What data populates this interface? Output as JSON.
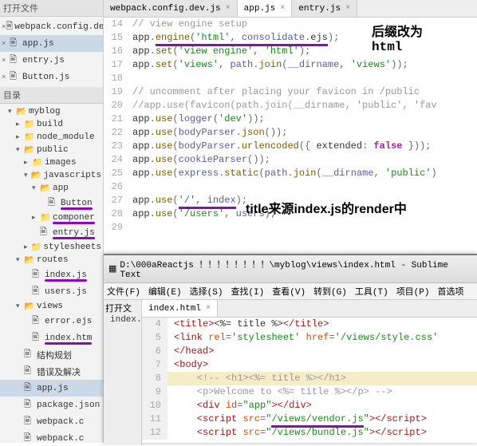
{
  "sidebar": {
    "header": "打开文件",
    "dir_header": "目录",
    "items": [
      {
        "label": "webpack.config.dev"
      },
      {
        "label": "app.js",
        "sel": true
      },
      {
        "label": "entry.js"
      },
      {
        "label": "Button.js"
      }
    ],
    "tree": [
      {
        "d": 1,
        "open": true,
        "fold": true,
        "label": "myblog"
      },
      {
        "d": 2,
        "open": false,
        "fold": true,
        "label": "build"
      },
      {
        "d": 2,
        "open": false,
        "fold": true,
        "label": "node_module"
      },
      {
        "d": 2,
        "open": true,
        "fold": true,
        "label": "public"
      },
      {
        "d": 3,
        "open": false,
        "fold": true,
        "label": "images"
      },
      {
        "d": 3,
        "open": true,
        "fold": true,
        "label": "javascripts"
      },
      {
        "d": 4,
        "open": true,
        "fold": true,
        "label": "app"
      },
      {
        "d": 5,
        "fold": false,
        "label": "Button",
        "mark": true
      },
      {
        "d": 4,
        "open": false,
        "fold": true,
        "label": "componer",
        "mark": true
      },
      {
        "d": 4,
        "fold": false,
        "label": "entry.js",
        "mark": true
      },
      {
        "d": 3,
        "open": false,
        "fold": true,
        "label": "stylesheets"
      },
      {
        "d": 2,
        "open": true,
        "fold": true,
        "label": "routes"
      },
      {
        "d": 3,
        "fold": false,
        "label": "index.js",
        "mark": true
      },
      {
        "d": 3,
        "fold": false,
        "label": "users.js"
      },
      {
        "d": 2,
        "open": true,
        "fold": true,
        "label": "views"
      },
      {
        "d": 3,
        "fold": false,
        "label": "error.ejs"
      },
      {
        "d": 3,
        "fold": false,
        "label": "index.htm",
        "mark": true
      },
      {
        "d": 2,
        "fold": false,
        "label": "结构规划"
      },
      {
        "d": 2,
        "fold": false,
        "label": "错误及解决"
      },
      {
        "d": 2,
        "fold": false,
        "label": "app.js",
        "sel": true
      },
      {
        "d": 2,
        "fold": false,
        "label": "package.json"
      },
      {
        "d": 2,
        "fold": false,
        "label": "webpack.c"
      },
      {
        "d": 2,
        "fold": false,
        "label": "webpack.c"
      }
    ]
  },
  "tabs": [
    {
      "label": "webpack.config.dev.js"
    },
    {
      "label": "app.js",
      "active": true
    },
    {
      "label": "entry.js"
    }
  ],
  "annotations": {
    "a1_line1": "后缀改为",
    "a1_line2": "html",
    "a2": "title来源index.js的render中"
  },
  "code": [
    {
      "n": 14,
      "seg": [
        {
          "t": "// view engine setup",
          "c": "c-cm"
        }
      ]
    },
    {
      "n": 15,
      "seg": [
        {
          "t": "app",
          "c": "c-id"
        },
        {
          "t": ".",
          "c": "c-op"
        },
        {
          "t": "engine",
          "c": "c-fn",
          "u": true
        },
        {
          "t": "(",
          "c": "c-op",
          "u": true
        },
        {
          "t": "'html'",
          "c": "c-str",
          "u": true
        },
        {
          "t": ", ",
          "c": "c-op",
          "u": true
        },
        {
          "t": "consolidate",
          "c": "c-var",
          "u": true
        },
        {
          "t": ".",
          "c": "c-op",
          "u": true
        },
        {
          "t": "ejs",
          "c": "c-id",
          "u": true
        },
        {
          "t": ");",
          "c": "c-op"
        }
      ]
    },
    {
      "n": 16,
      "seg": [
        {
          "t": "app",
          "c": "c-id"
        },
        {
          "t": ".",
          "c": "c-op"
        },
        {
          "t": "set",
          "c": "c-fn"
        },
        {
          "t": "(",
          "c": "c-op"
        },
        {
          "t": "'view engine'",
          "c": "c-str"
        },
        {
          "t": ", ",
          "c": "c-op"
        },
        {
          "t": "'html'",
          "c": "c-str"
        },
        {
          "t": ");",
          "c": "c-op"
        }
      ]
    },
    {
      "n": 17,
      "seg": [
        {
          "t": "app",
          "c": "c-id"
        },
        {
          "t": ".",
          "c": "c-op"
        },
        {
          "t": "set",
          "c": "c-fn"
        },
        {
          "t": "(",
          "c": "c-op"
        },
        {
          "t": "'views'",
          "c": "c-str"
        },
        {
          "t": ", ",
          "c": "c-op"
        },
        {
          "t": "path",
          "c": "c-var"
        },
        {
          "t": ".",
          "c": "c-op"
        },
        {
          "t": "join",
          "c": "c-fn"
        },
        {
          "t": "(",
          "c": "c-op"
        },
        {
          "t": "__dirname",
          "c": "c-var"
        },
        {
          "t": ", ",
          "c": "c-op"
        },
        {
          "t": "'views'",
          "c": "c-str"
        },
        {
          "t": "));",
          "c": "c-op"
        }
      ]
    },
    {
      "n": 18,
      "seg": []
    },
    {
      "n": 19,
      "seg": [
        {
          "t": "// uncomment after placing your favicon in /public",
          "c": "c-cm"
        }
      ]
    },
    {
      "n": 20,
      "seg": [
        {
          "t": "//app.use(favicon(path.join(__dirname, 'public', 'fav",
          "c": "c-cm"
        }
      ]
    },
    {
      "n": 21,
      "seg": [
        {
          "t": "app",
          "c": "c-id"
        },
        {
          "t": ".",
          "c": "c-op"
        },
        {
          "t": "use",
          "c": "c-fn"
        },
        {
          "t": "(",
          "c": "c-op"
        },
        {
          "t": "logger",
          "c": "c-var"
        },
        {
          "t": "(",
          "c": "c-op"
        },
        {
          "t": "'dev'",
          "c": "c-str"
        },
        {
          "t": "));",
          "c": "c-op"
        }
      ]
    },
    {
      "n": 22,
      "seg": [
        {
          "t": "app",
          "c": "c-id"
        },
        {
          "t": ".",
          "c": "c-op"
        },
        {
          "t": "use",
          "c": "c-fn"
        },
        {
          "t": "(",
          "c": "c-op"
        },
        {
          "t": "bodyParser",
          "c": "c-var"
        },
        {
          "t": ".",
          "c": "c-op"
        },
        {
          "t": "json",
          "c": "c-fn"
        },
        {
          "t": "());",
          "c": "c-op"
        }
      ]
    },
    {
      "n": 23,
      "seg": [
        {
          "t": "app",
          "c": "c-id"
        },
        {
          "t": ".",
          "c": "c-op"
        },
        {
          "t": "use",
          "c": "c-fn"
        },
        {
          "t": "(",
          "c": "c-op"
        },
        {
          "t": "bodyParser",
          "c": "c-var"
        },
        {
          "t": ".",
          "c": "c-op"
        },
        {
          "t": "urlencoded",
          "c": "c-fn"
        },
        {
          "t": "({ ",
          "c": "c-op"
        },
        {
          "t": "extended",
          "c": "c-id"
        },
        {
          "t": ": ",
          "c": "c-op"
        },
        {
          "t": "false",
          "c": "c-bool"
        },
        {
          "t": " }));",
          "c": "c-op"
        }
      ]
    },
    {
      "n": 24,
      "seg": [
        {
          "t": "app",
          "c": "c-id"
        },
        {
          "t": ".",
          "c": "c-op"
        },
        {
          "t": "use",
          "c": "c-fn"
        },
        {
          "t": "(",
          "c": "c-op"
        },
        {
          "t": "cookieParser",
          "c": "c-var"
        },
        {
          "t": "());",
          "c": "c-op"
        }
      ]
    },
    {
      "n": 25,
      "seg": [
        {
          "t": "app",
          "c": "c-id"
        },
        {
          "t": ".",
          "c": "c-op"
        },
        {
          "t": "use",
          "c": "c-fn"
        },
        {
          "t": "(",
          "c": "c-op"
        },
        {
          "t": "express",
          "c": "c-var"
        },
        {
          "t": ".",
          "c": "c-op"
        },
        {
          "t": "static",
          "c": "c-fn"
        },
        {
          "t": "(",
          "c": "c-op"
        },
        {
          "t": "path",
          "c": "c-var"
        },
        {
          "t": ".",
          "c": "c-op"
        },
        {
          "t": "join",
          "c": "c-fn"
        },
        {
          "t": "(",
          "c": "c-op"
        },
        {
          "t": "__dirname",
          "c": "c-var"
        },
        {
          "t": ", ",
          "c": "c-op"
        },
        {
          "t": "'public'",
          "c": "c-str"
        },
        {
          "t": ")",
          "c": "c-op"
        }
      ]
    },
    {
      "n": 26,
      "seg": []
    },
    {
      "n": 27,
      "seg": [
        {
          "t": "app",
          "c": "c-id"
        },
        {
          "t": ".",
          "c": "c-op"
        },
        {
          "t": "use",
          "c": "c-fn"
        },
        {
          "t": "(",
          "c": "c-op"
        },
        {
          "t": "'/'",
          "c": "c-str",
          "u": true
        },
        {
          "t": ", ",
          "c": "c-op",
          "u": true
        },
        {
          "t": "index",
          "c": "c-var",
          "u": true
        },
        {
          "t": ");",
          "c": "c-op"
        }
      ]
    },
    {
      "n": 28,
      "seg": [
        {
          "t": "app",
          "c": "c-id"
        },
        {
          "t": ".",
          "c": "c-op"
        },
        {
          "t": "use",
          "c": "c-fn"
        },
        {
          "t": "(",
          "c": "c-op"
        },
        {
          "t": "'/users'",
          "c": "c-str"
        },
        {
          "t": ", ",
          "c": "c-op"
        },
        {
          "t": "users",
          "c": "c-var"
        },
        {
          "t": ");",
          "c": "c-op"
        }
      ]
    },
    {
      "n": 29,
      "seg": []
    }
  ],
  "sublime": {
    "title_path": "D:\\000aReactjs ！！！！！！！！\\myblog\\views\\index.html - Sublime Text",
    "menu": [
      "文件(F)",
      "编辑(E)",
      "选择(S)",
      "查找(I)",
      "查看(V)",
      "转到(G)",
      "工具(T)",
      "项目(P)",
      "首选项"
    ],
    "side_label": "打开文",
    "side_item": "index.h",
    "tab": "index.html",
    "code": [
      {
        "n": 4,
        "seg": [
          {
            "t": "<",
            "c": "c-tag"
          },
          {
            "t": "title",
            "c": "c-tag"
          },
          {
            "t": ">",
            "c": "c-tag"
          },
          {
            "t": "<%= title %>",
            "c": "c-id"
          },
          {
            "t": "</",
            "c": "c-tag"
          },
          {
            "t": "title",
            "c": "c-tag"
          },
          {
            "t": ">",
            "c": "c-tag"
          }
        ]
      },
      {
        "n": 5,
        "seg": [
          {
            "t": "<",
            "c": "c-tag"
          },
          {
            "t": "link ",
            "c": "c-tag"
          },
          {
            "t": "rel",
            "c": "c-attr"
          },
          {
            "t": "=",
            "c": "c-op"
          },
          {
            "t": "'stylesheet'",
            "c": "c-sstr"
          },
          {
            "t": " ",
            "c": ""
          },
          {
            "t": "href",
            "c": "c-attr"
          },
          {
            "t": "=",
            "c": "c-op"
          },
          {
            "t": "'/views/style.css'",
            "c": "c-sstr"
          }
        ]
      },
      {
        "n": 6,
        "seg": [
          {
            "t": "</",
            "c": "c-tag"
          },
          {
            "t": "head",
            "c": "c-tag"
          },
          {
            "t": ">",
            "c": "c-tag"
          }
        ]
      },
      {
        "n": 7,
        "seg": [
          {
            "t": "<",
            "c": "c-tag"
          },
          {
            "t": "body",
            "c": "c-tag"
          },
          {
            "t": ">",
            "c": "c-tag"
          }
        ]
      },
      {
        "n": 8,
        "hl": true,
        "seg": [
          {
            "t": "    <!-- <h1><%= title %></h1>",
            "c": "c-cm"
          }
        ]
      },
      {
        "n": 9,
        "seg": [
          {
            "t": "    <p>Welcome to <%= title %></p> -->",
            "c": "c-cm"
          }
        ]
      },
      {
        "n": 10,
        "seg": [
          {
            "t": "    <",
            "c": "c-tag"
          },
          {
            "t": "div ",
            "c": "c-tag"
          },
          {
            "t": "id",
            "c": "c-attr"
          },
          {
            "t": "=",
            "c": "c-op"
          },
          {
            "t": "\"app\"",
            "c": "c-sstr"
          },
          {
            "t": "></",
            "c": "c-tag"
          },
          {
            "t": "div",
            "c": "c-tag"
          },
          {
            "t": ">",
            "c": "c-tag"
          }
        ]
      },
      {
        "n": 11,
        "seg": [
          {
            "t": "    <",
            "c": "c-tag"
          },
          {
            "t": "script ",
            "c": "c-tag"
          },
          {
            "t": "src",
            "c": "c-attr"
          },
          {
            "t": "=",
            "c": "c-op"
          },
          {
            "t": "\"",
            "c": "c-sstr"
          },
          {
            "t": "/views/vendor.js",
            "c": "c-sstr",
            "u": true
          },
          {
            "t": "\"",
            "c": "c-sstr"
          },
          {
            "t": "></",
            "c": "c-tag"
          },
          {
            "t": "script",
            "c": "c-tag"
          },
          {
            "t": ">",
            "c": "c-tag"
          }
        ]
      },
      {
        "n": 12,
        "seg": [
          {
            "t": "    <",
            "c": "c-tag"
          },
          {
            "t": "script ",
            "c": "c-tag"
          },
          {
            "t": "src",
            "c": "c-attr"
          },
          {
            "t": "=",
            "c": "c-op"
          },
          {
            "t": "\"/views/bundle.js\"",
            "c": "c-sstr"
          },
          {
            "t": "></",
            "c": "c-tag"
          },
          {
            "t": "script",
            "c": "c-tag"
          },
          {
            "t": ">",
            "c": "c-tag"
          }
        ]
      }
    ]
  }
}
